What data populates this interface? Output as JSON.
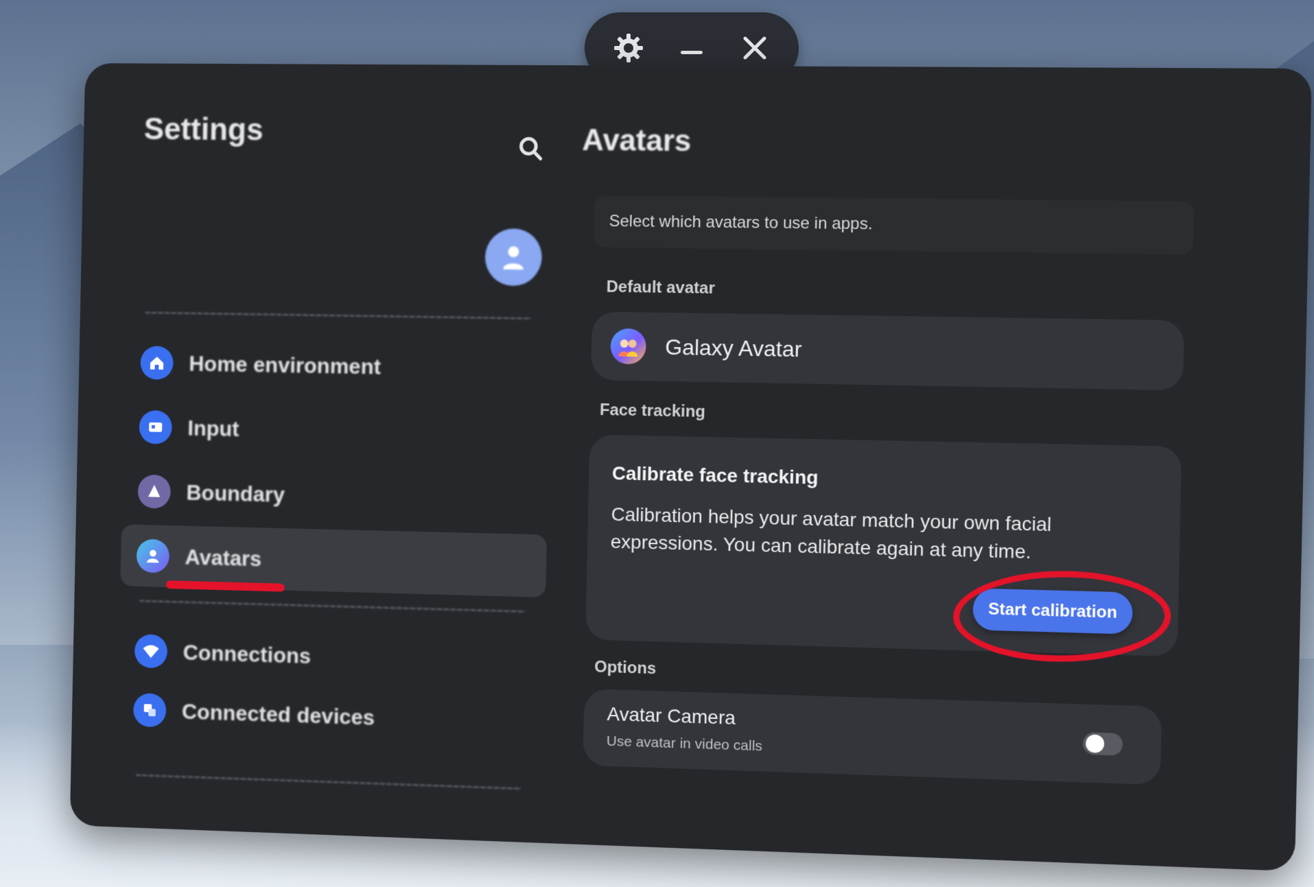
{
  "window_controls": {
    "icons": [
      "settings-gear-icon",
      "minimize-icon",
      "close-icon"
    ]
  },
  "sidebar": {
    "title": "Settings",
    "search_icon": "search-icon",
    "profile_icon": "user-icon",
    "items": [
      {
        "label": "Home environment",
        "icon": "home-icon",
        "color": "#3a6ff0",
        "active": false
      },
      {
        "label": "Input",
        "icon": "input-icon",
        "color": "#3a6ff0",
        "active": false
      },
      {
        "label": "Boundary",
        "icon": "boundary-icon",
        "color": "#6f6aa6",
        "active": false
      },
      {
        "label": "Avatars",
        "icon": "avatar-icon",
        "color": "#5f7df2",
        "active": true
      },
      {
        "label": "Connections",
        "icon": "wifi-icon",
        "color": "#3a6ff0",
        "active": false
      },
      {
        "label": "Connected devices",
        "icon": "devices-icon",
        "color": "#3a6ff0",
        "active": false
      }
    ]
  },
  "content": {
    "title": "Avatars",
    "subtitle": "Select which avatars to use in apps.",
    "default_avatar": {
      "section_label": "Default avatar",
      "name": "Galaxy Avatar"
    },
    "face_tracking": {
      "section_label": "Face tracking",
      "title": "Calibrate face tracking",
      "description": "Calibration helps your avatar match your own facial expressions. You can calibrate again at any time.",
      "button_label": "Start calibration"
    },
    "options": {
      "section_label": "Options",
      "title": "Avatar Camera",
      "subtitle": "Use avatar in video calls",
      "toggle_on": false
    }
  },
  "colors": {
    "accent": "#4a74ea",
    "annotation": "#e4132a",
    "panel": "#25272b",
    "card": "#33353a"
  }
}
